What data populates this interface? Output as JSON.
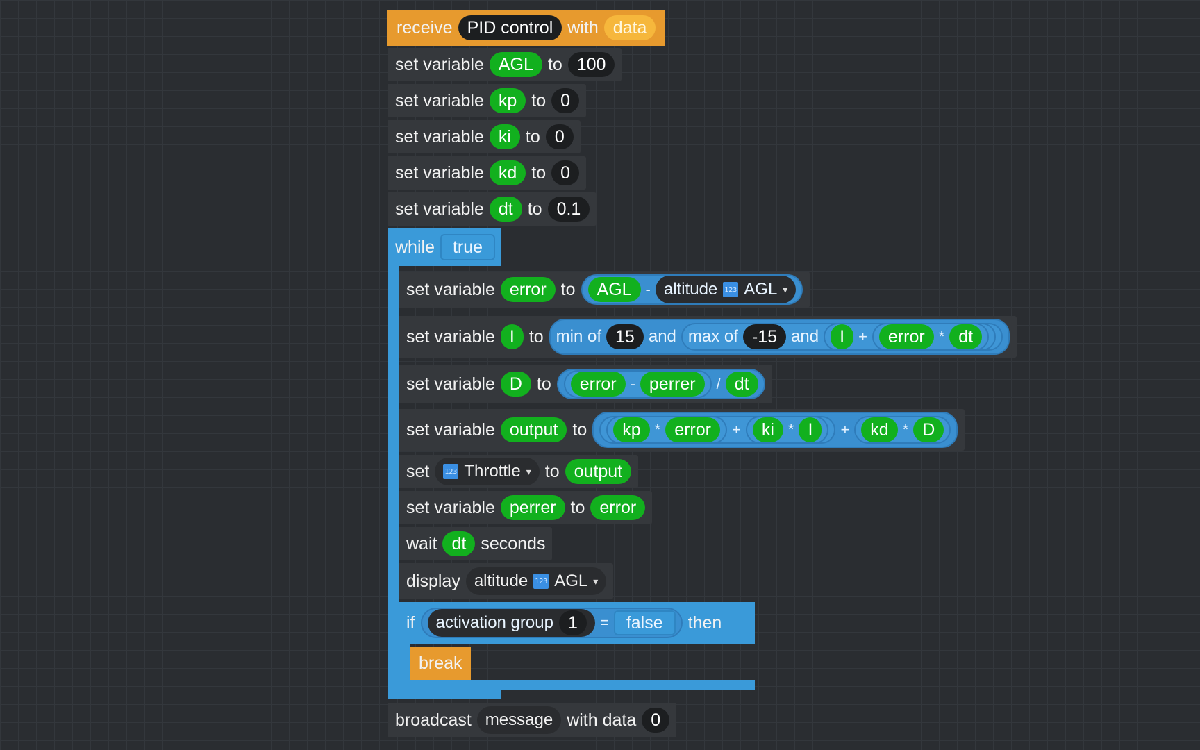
{
  "event": {
    "keyword": "receive",
    "name": "PID control",
    "with_label": "with",
    "param": "data"
  },
  "set_label": "set",
  "set_variable_label": "set variable",
  "to_label": "to",
  "init_vars": [
    {
      "name": "AGL",
      "value": "100"
    },
    {
      "name": "kp",
      "value": "0"
    },
    {
      "name": "ki",
      "value": "0"
    },
    {
      "name": "kd",
      "value": "0"
    },
    {
      "name": "dt",
      "value": "0.1"
    }
  ],
  "loop": {
    "keyword": "while",
    "condition": "true"
  },
  "error_stmt": {
    "var": "error",
    "lhs": "AGL",
    "op": "-",
    "sensor_label": "altitude",
    "sensor_option": "AGL"
  },
  "i_stmt": {
    "var": "I",
    "min_label": "min of",
    "min_value": "15",
    "and_label": "and",
    "max_label": "max of",
    "max_value": "-15",
    "sum_lhs": "I",
    "plus": "+",
    "mul_lhs": "error",
    "times": "*",
    "mul_rhs": "dt"
  },
  "d_stmt": {
    "var": "D",
    "a": "error",
    "minus": "-",
    "b": "perrer",
    "div": "/",
    "c": "dt"
  },
  "output_stmt": {
    "var": "output",
    "t1a": "kp",
    "t1b": "error",
    "t2a": "ki",
    "t2b": "I",
    "t3a": "kd",
    "t3b": "D",
    "times": "*",
    "plus": "+"
  },
  "throttle_stmt": {
    "control": "Throttle",
    "value": "output"
  },
  "perrer_stmt": {
    "var": "perrer",
    "value": "error"
  },
  "wait_stmt": {
    "keyword": "wait",
    "var": "dt",
    "unit": "seconds"
  },
  "display_stmt": {
    "keyword": "display",
    "sensor_label": "altitude",
    "sensor_option": "AGL"
  },
  "if_stmt": {
    "keyword": "if",
    "sensor_label": "activation group",
    "group": "1",
    "eq": "=",
    "rhs": "false",
    "then_label": "then",
    "break_label": "break"
  },
  "broadcast_stmt": {
    "keyword": "broadcast",
    "message": "message",
    "with_data_label": "with data",
    "value": "0"
  },
  "icon_glyph": "123",
  "colors": {
    "background": "#2a2d31",
    "event": "#e79a2e",
    "control": "#3a9ad9",
    "variable": "#12b01e",
    "statement": "#35383c"
  }
}
